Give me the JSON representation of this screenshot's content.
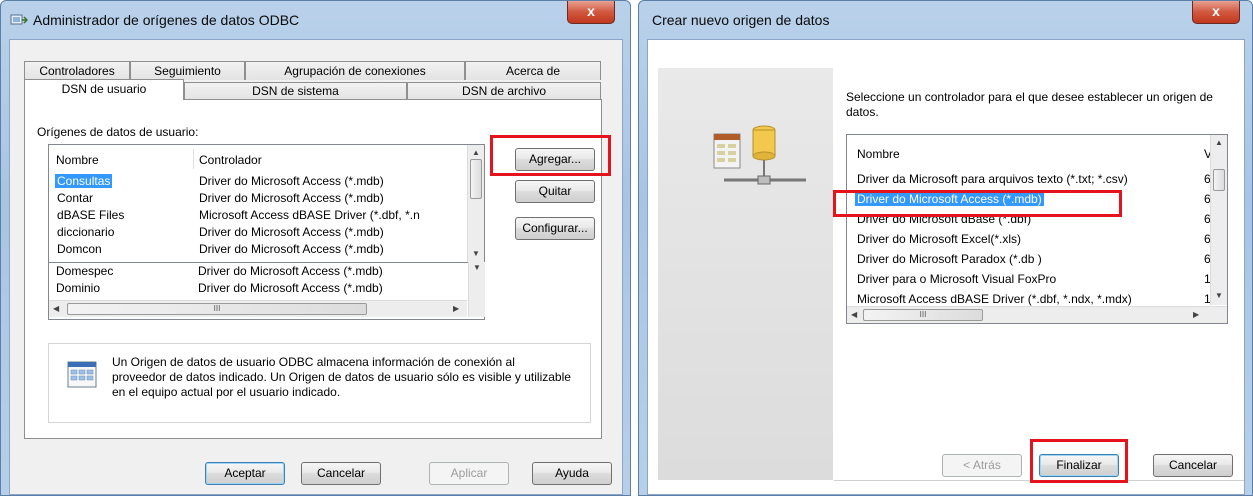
{
  "left_dialog": {
    "title": "Administrador de orígenes de datos ODBC",
    "close": "x",
    "tabs_top": [
      "Controladores",
      "Seguimiento",
      "Agrupación de conexiones",
      "Acerca de"
    ],
    "tabs_bottom": [
      "DSN de usuario",
      "DSN de sistema",
      "DSN de archivo"
    ],
    "section_label": "Orígenes de datos de usuario:",
    "columns": [
      "Nombre",
      "Controlador"
    ],
    "rows": [
      [
        "Consultas",
        "Driver do Microsoft Access (*.mdb)"
      ],
      [
        "Contar",
        "Driver do Microsoft Access (*.mdb)"
      ],
      [
        "dBASE Files",
        "Microsoft Access dBASE Driver (*.dbf, *.n"
      ],
      [
        "diccionario",
        "Driver do Microsoft Access (*.mdb)"
      ],
      [
        "Domcon",
        "Driver do Microsoft Access (*.mdb)"
      ],
      [
        "Domespec",
        "Driver do Microsoft Access (*.mdb)"
      ],
      [
        "Dominio",
        "Driver do Microsoft Access (*.mdb)"
      ]
    ],
    "hscroll_grip": "III",
    "buttons": {
      "add": "Agregar...",
      "remove": "Quitar",
      "configure": "Configurar..."
    },
    "info_text": "Un Origen de datos de usuario ODBC almacena información de conexión al proveedor de datos indicado. Un Origen de datos de usuario sólo es visible y utilizable en el equipo actual por el usuario indicado.",
    "footer": {
      "ok": "Aceptar",
      "cancel": "Cancelar",
      "apply": "Aplicar",
      "help": "Ayuda"
    }
  },
  "right_dialog": {
    "title": "Crear nuevo origen de datos",
    "close": "x",
    "prompt": "Seleccione un controlador para el que desee establecer un origen de datos.",
    "column": "Nombre",
    "column2": "V",
    "drivers": [
      {
        "name": "Driver da Microsoft para arquivos texto (*.txt; *.csv)",
        "ver": "6"
      },
      {
        "name": "Driver do Microsoft Access (*.mdb)",
        "ver": "6"
      },
      {
        "name": "Driver do Microsoft dBase (*.dbf)",
        "ver": "6"
      },
      {
        "name": "Driver do Microsoft Excel(*.xls)",
        "ver": "6"
      },
      {
        "name": "Driver do Microsoft Paradox (*.db )",
        "ver": "6"
      },
      {
        "name": "Driver para o Microsoft Visual FoxPro",
        "ver": "1"
      },
      {
        "name": "Microsoft Access dBASE Driver (*.dbf, *.ndx, *.mdx)",
        "ver": "1"
      }
    ],
    "hscroll_grip": "III",
    "buttons": {
      "back": "< Atrás",
      "finish": "Finalizar",
      "cancel": "Cancelar"
    }
  },
  "colors": {
    "highlight": "#e4131c",
    "selection": "#3399ff"
  }
}
